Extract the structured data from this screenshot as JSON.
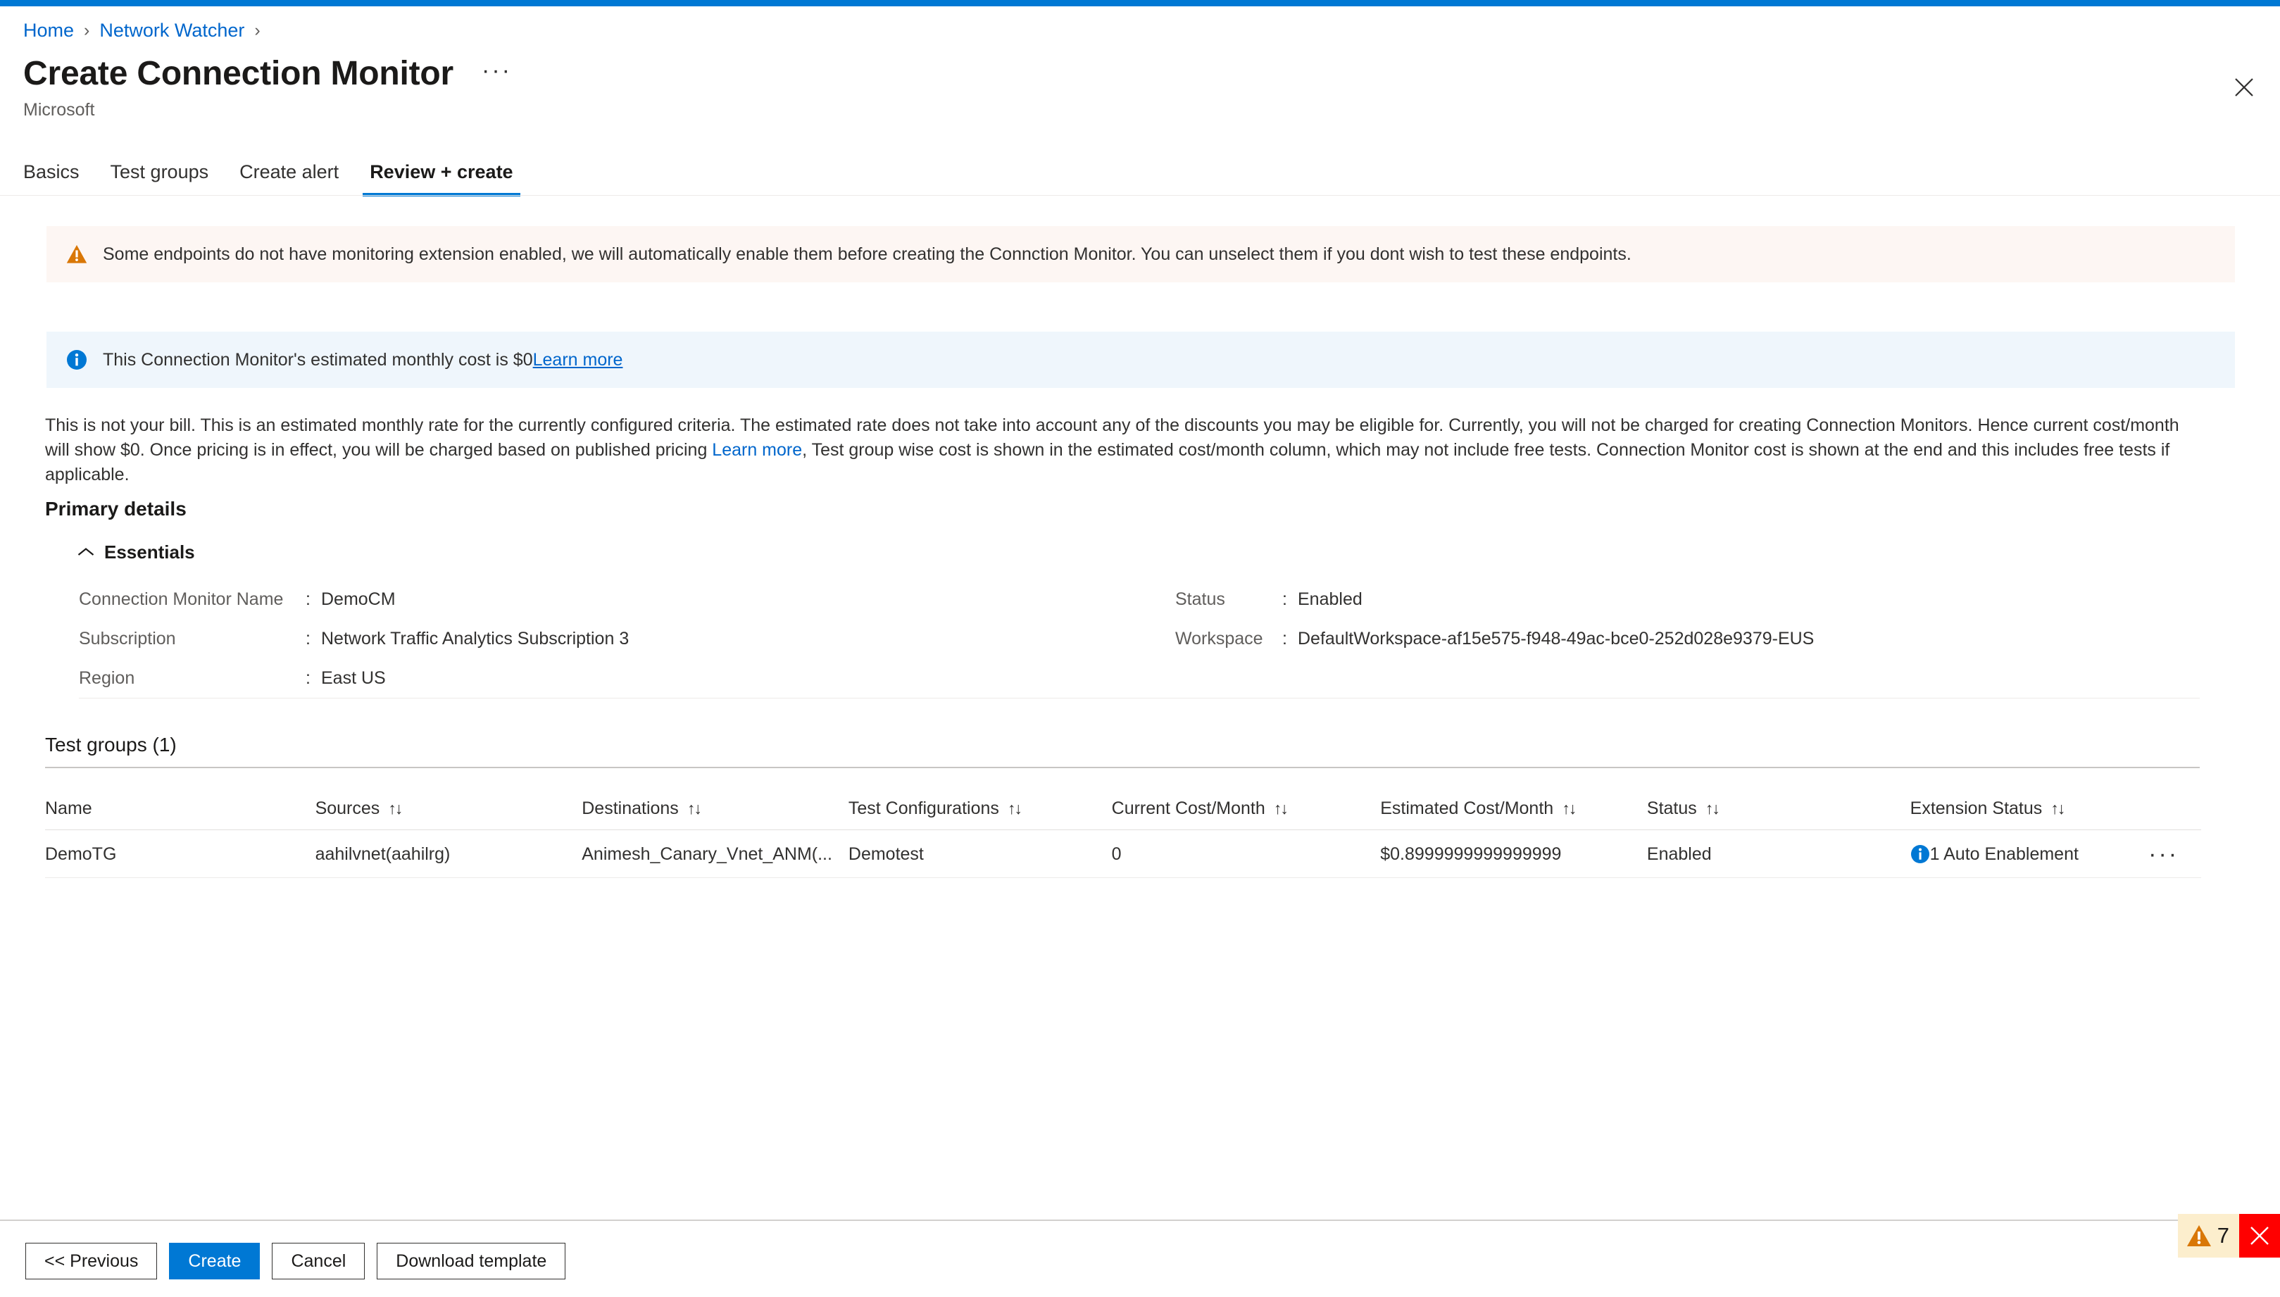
{
  "breadcrumb": {
    "items": [
      {
        "label": "Home"
      },
      {
        "label": "Network Watcher"
      }
    ],
    "separator": "›"
  },
  "header": {
    "title": "Create Connection Monitor",
    "ellipsis": "···",
    "subtitle": "Microsoft",
    "close_icon": "close-icon"
  },
  "tabs": [
    {
      "label": "Basics",
      "active": false
    },
    {
      "label": "Test groups",
      "active": false
    },
    {
      "label": "Create alert",
      "active": false
    },
    {
      "label": "Review + create",
      "active": true
    }
  ],
  "banners": {
    "warning": {
      "icon": "warning-triangle-icon",
      "text": "Some endpoints do not have monitoring extension enabled, we will automatically enable them before creating the Connction Monitor. You can unselect them if you dont wish to test these endpoints.",
      "background": "#fdf6f3"
    },
    "info": {
      "icon": "info-circle-icon",
      "text": "This Connection Monitor's estimated monthly cost is $0",
      "link_label": "Learn more",
      "background": "#eff6fc"
    }
  },
  "disclaimer": {
    "part1": "This is not your bill. This is an estimated monthly rate for the currently configured criteria. The estimated rate does not take into account any of the discounts you may be eligible for. Currently, you will not be charged for creating Connection Monitors. Hence current cost/month will show $0. Once pricing is in effect, you will be charged based on published pricing ",
    "link_label": "Learn more",
    "part2": ", Test group wise cost is shown in the estimated cost/month column, which may not include free tests. Connection Monitor cost is shown at the end and this includes free tests if applicable."
  },
  "primary_details": {
    "section_title": "Primary details",
    "essentials_label": "Essentials",
    "essentials_expanded": true,
    "rows": [
      {
        "left_key": "Connection Monitor Name",
        "left_value": "DemoCM",
        "right_key": "Status",
        "right_value": "Enabled"
      },
      {
        "left_key": "Subscription",
        "left_value": "Network Traffic Analytics Subscription 3",
        "right_key": "Workspace",
        "right_value": "DefaultWorkspace-af15e575-f948-49ac-bce0-252d028e9379-EUS"
      },
      {
        "left_key": "Region",
        "left_value": "East US",
        "right_key": "",
        "right_value": ""
      }
    ],
    "colon": ":"
  },
  "test_groups": {
    "heading": "Test groups (1)",
    "sort_glyph": "↑↓",
    "columns": [
      {
        "label": "Name",
        "sortable": false
      },
      {
        "label": "Sources",
        "sortable": true
      },
      {
        "label": "Destinations",
        "sortable": true
      },
      {
        "label": "Test Configurations",
        "sortable": true
      },
      {
        "label": "Current Cost/Month",
        "sortable": true
      },
      {
        "label": "Estimated Cost/Month",
        "sortable": true
      },
      {
        "label": "Status",
        "sortable": true
      },
      {
        "label": "Extension Status",
        "sortable": true
      }
    ],
    "rows": [
      {
        "name": "DemoTG",
        "sources": "aahilvnet(aahilrg)",
        "destinations": "Animesh_Canary_Vnet_ANM(...",
        "test_configurations": "Demotest",
        "current_cost_month": "0",
        "estimated_cost_month": "$0.8999999999999999",
        "status": "Enabled",
        "extension_status": "1 Auto Enablement",
        "extension_status_icon": "info-circle-icon",
        "more_glyph": "···"
      }
    ]
  },
  "footer": {
    "buttons": [
      {
        "label": "<< Previous",
        "style": "default"
      },
      {
        "label": "Create",
        "style": "primary"
      },
      {
        "label": "Cancel",
        "style": "default"
      },
      {
        "label": "Download template",
        "style": "default"
      }
    ],
    "status_badge": {
      "warning_icon": "warning-triangle-icon",
      "warning_count": "7",
      "close_icon": "close-icon",
      "warning_background": "#fceecd",
      "close_background": "#ff0000"
    }
  },
  "colors": {
    "accent": "#0078d4",
    "link": "#0066cc",
    "warning": "#d83b01",
    "info": "#0078d4",
    "danger": "#ff0000",
    "text": "#323130",
    "muted": "#605e5c"
  }
}
